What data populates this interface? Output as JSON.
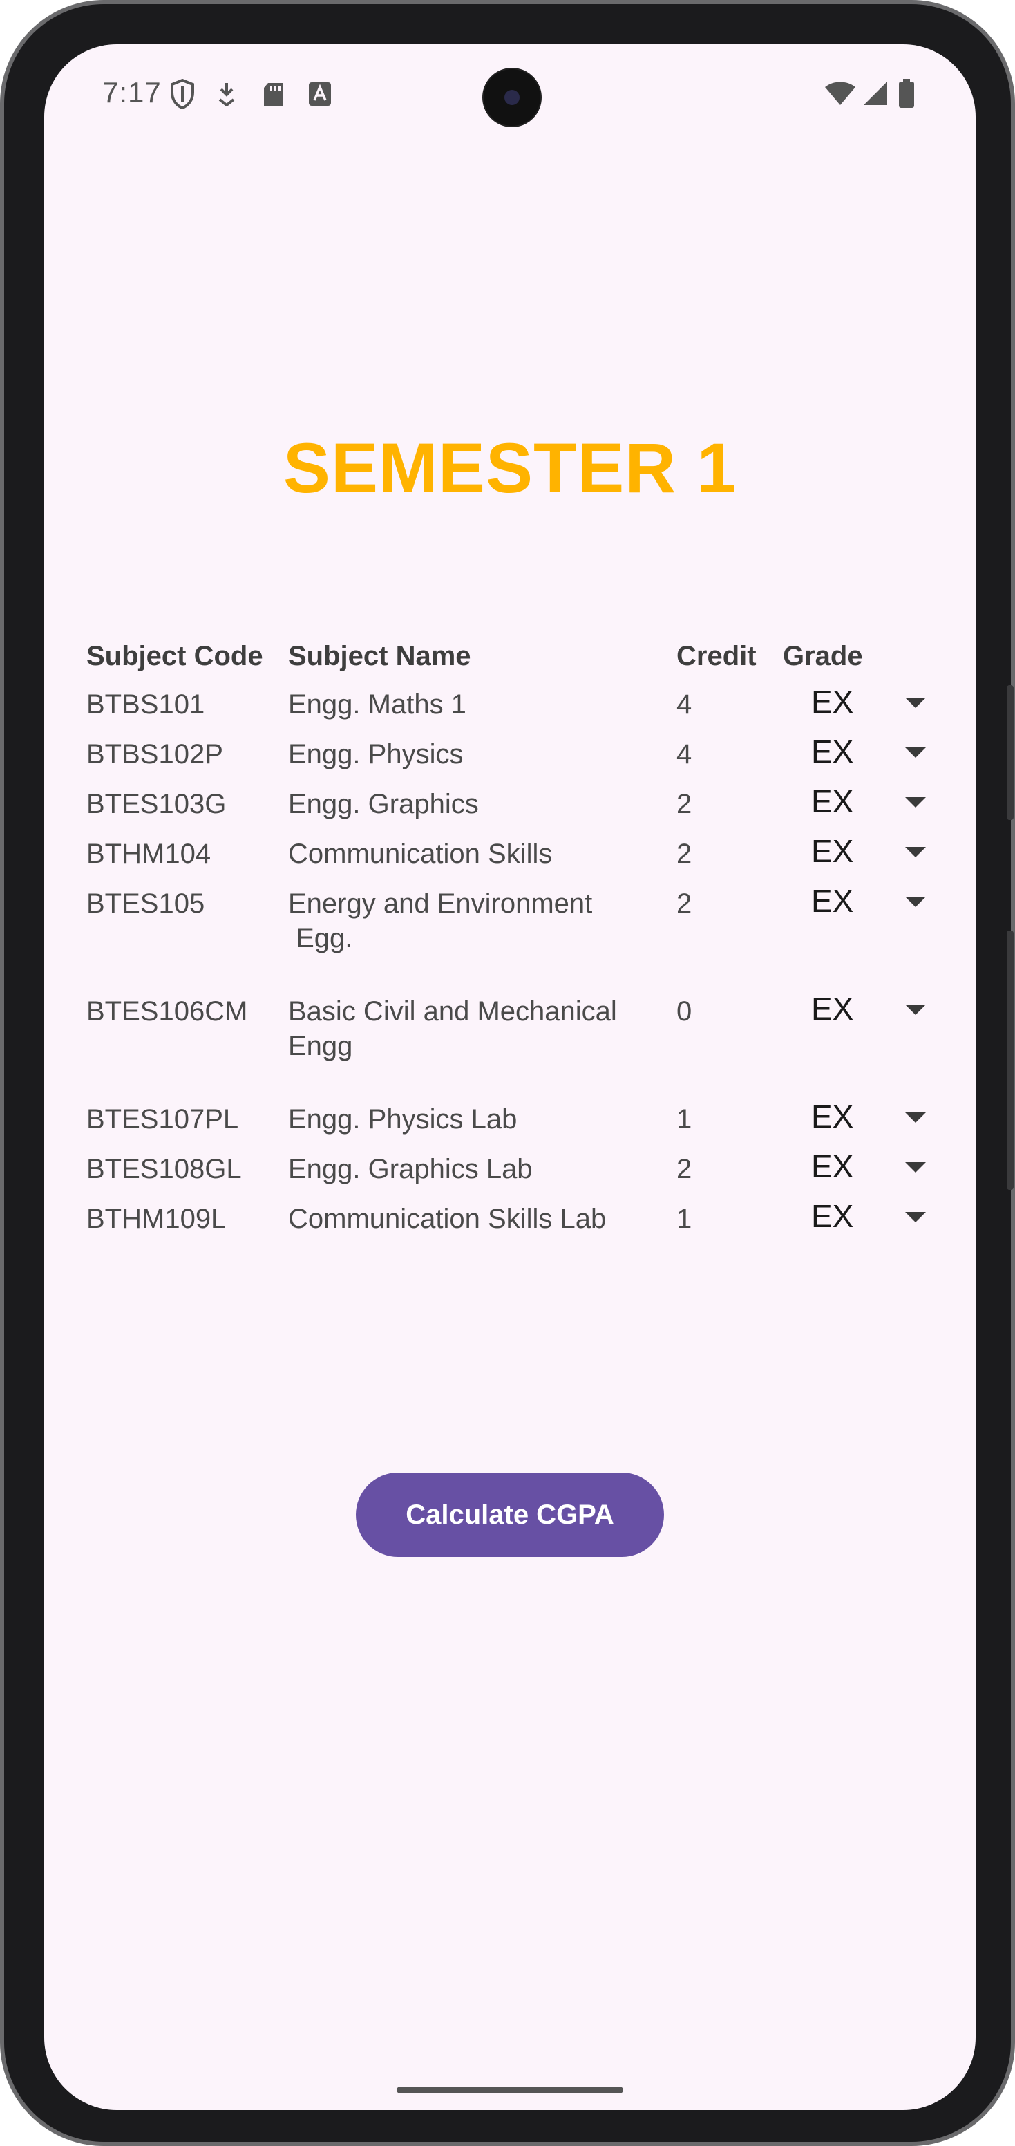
{
  "status_bar": {
    "time": "7:17",
    "left_icons": [
      "shield-icon",
      "download-icon",
      "sd-card-icon",
      "font-icon"
    ],
    "right_icons": [
      "wifi-icon",
      "cell-signal-icon",
      "battery-icon"
    ]
  },
  "title": "SEMESTER 1",
  "table": {
    "headers": {
      "code": "Subject Code",
      "name": "Subject Name",
      "credit": "Credit",
      "grade": "Grade"
    },
    "rows": [
      {
        "code": "BTBS101",
        "name": "Engg. Maths 1",
        "credit": "4",
        "grade": "EX"
      },
      {
        "code": "BTBS102P",
        "name": "Engg. Physics",
        "credit": "4",
        "grade": "EX"
      },
      {
        "code": "BTES103G",
        "name": "Engg. Graphics",
        "credit": "2",
        "grade": "EX"
      },
      {
        "code": "BTHM104",
        "name": "Communication Skills",
        "credit": "2",
        "grade": "EX"
      },
      {
        "code": "BTES105",
        "name": "Energy and Environment\n Egg.",
        "credit": "2",
        "grade": "EX"
      },
      {
        "code": "BTES106CM",
        "name": "Basic Civil and Mechanical Engg",
        "credit": "0",
        "grade": "EX"
      },
      {
        "code": "BTES107PL",
        "name": "Engg. Physics Lab",
        "credit": "1",
        "grade": "EX"
      },
      {
        "code": "BTES108GL",
        "name": "Engg. Graphics Lab",
        "credit": "2",
        "grade": "EX"
      },
      {
        "code": "BTHM109L",
        "name": "Communication Skills Lab",
        "credit": "1",
        "grade": "EX"
      }
    ]
  },
  "button": {
    "label": "Calculate CGPA"
  },
  "colors": {
    "title": "#ffb300",
    "button": "#6750a4",
    "background": "#fcf4fb"
  }
}
